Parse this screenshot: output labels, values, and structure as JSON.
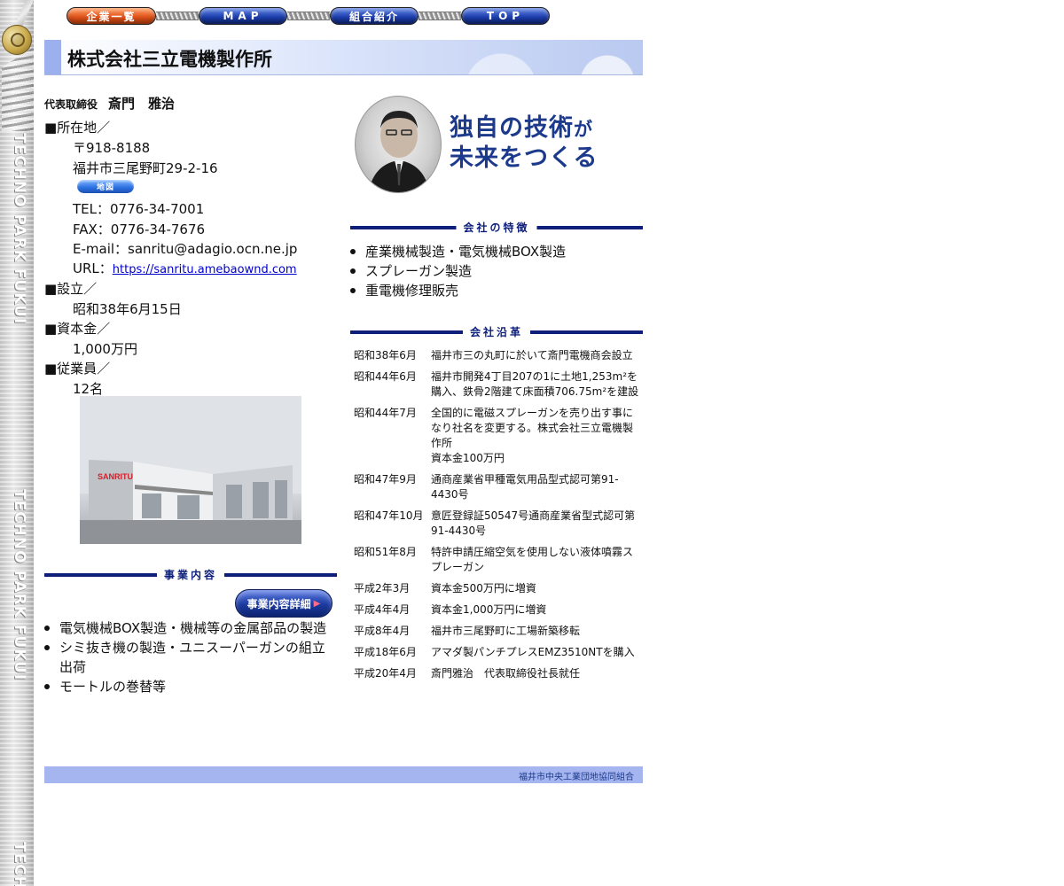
{
  "nav": {
    "items": [
      "企業一覧",
      "MAP",
      "組合紹介",
      "TOP"
    ]
  },
  "side_strip": {
    "text": "TECHNO PARK FUKUI",
    "text_partial": "TECH"
  },
  "company": {
    "name": "株式会社三立電機製作所"
  },
  "representative": {
    "title": "代表取締役",
    "name": "斎門　雅治"
  },
  "info": {
    "address_label": "■所在地／",
    "postal": "〒918-8188",
    "address": "福井市三尾野町29-2-16",
    "map_button": "地図",
    "tel": "TEL：0776-34-7001",
    "fax": "FAX：0776-34-7676",
    "email": "E-mail：sanritu@adagio.ocn.ne.jp",
    "url_label": "URL：",
    "url": "https://sanritu.amebaownd.com",
    "founded_label": "■設立／",
    "founded": "昭和38年6月15日",
    "capital_label": "■資本金／",
    "capital": "1,000万円",
    "employees_label": "■従業員／",
    "employees": "12名"
  },
  "photo": {
    "sign_text": "SANRITU"
  },
  "business": {
    "heading": "事業内容",
    "detail_button": "事業内容詳細",
    "items": [
      "電気機械BOX製造・機械等の金属部品の製造",
      "シミ抜き機の製造・ユニスーパーガンの組立出荷",
      "モートルの巻替等"
    ]
  },
  "tagline": {
    "line1_a": "独自の技術",
    "line1_b": "が",
    "line2_a": "未来",
    "line2_b": "をつくる"
  },
  "features": {
    "heading": "会社の特徴",
    "items": [
      "産業機械製造・電気機械BOX製造",
      "スプレーガン製造",
      "重電機修理販売"
    ]
  },
  "history": {
    "heading": "会社沿革",
    "rows": [
      {
        "date": "昭和38年6月",
        "event": "福井市三の丸町に於いて斎門電機商会設立"
      },
      {
        "date": "昭和44年6月",
        "event": "福井市開発4丁目207の1に土地1,253m²を購入、鉄骨2階建て床面積706.75m²を建設"
      },
      {
        "date": "昭和44年7月",
        "event": "全国的に電磁スプレーガンを売り出す事になり社名を変更する。株式会社三立電機製作所"
      },
      {
        "date": "",
        "event": "資本金100万円"
      },
      {
        "date": "昭和47年9月",
        "event": "通商産業省甲種電気用品型式認可第91-4430号"
      },
      {
        "date": "昭和47年10月",
        "event": "意匠登録証50547号通商産業省型式認可第91-4430号"
      },
      {
        "date": "昭和51年8月",
        "event": "特許申請圧縮空気を使用しない液体噴霧スプレーガン"
      },
      {
        "date": "平成2年3月",
        "event": "資本金500万円に増資"
      },
      {
        "date": "平成4年4月",
        "event": "資本金1,000万円に増資"
      },
      {
        "date": "平成8年4月",
        "event": "福井市三尾野町に工場新築移転"
      },
      {
        "date": "平成18年6月",
        "event": "アマダ製パンチプレスEMZ3510NTを購入"
      },
      {
        "date": "平成20年4月",
        "event": "斎門雅治　代表取締役社長就任"
      }
    ]
  },
  "footer": {
    "text": "福井市中央工業団地協同組合"
  }
}
